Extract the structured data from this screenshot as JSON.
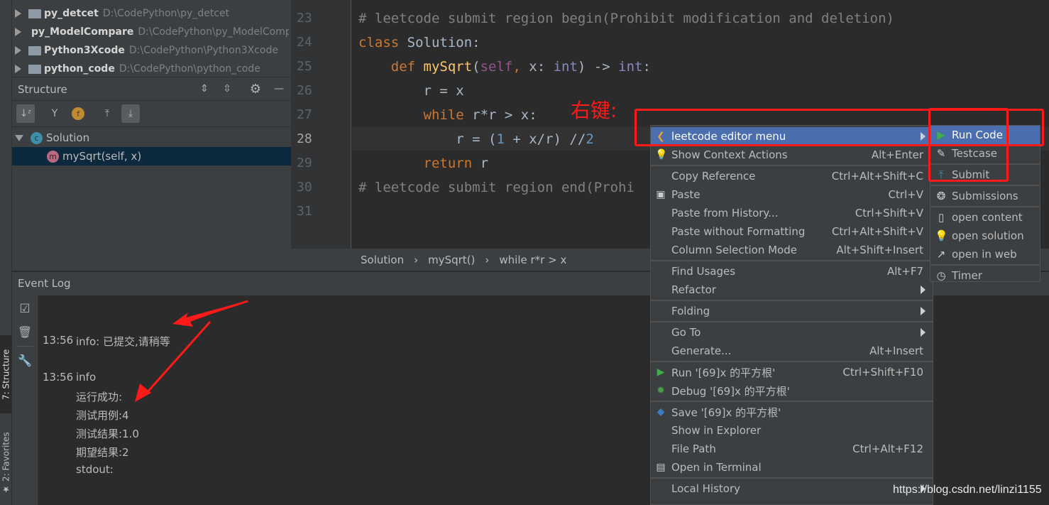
{
  "project_tree": [
    {
      "name": "py_detcet",
      "path": "D:\\CodePython\\py_detcet"
    },
    {
      "name": "py_ModelCompare",
      "path": "D:\\CodePython\\py_ModelCompare"
    },
    {
      "name": "Python3Xcode",
      "path": "D:\\CodePython\\Python3Xcode"
    },
    {
      "name": "python_code",
      "path": "D:\\CodePython\\python_code"
    }
  ],
  "structure": {
    "title": "Structure",
    "class_badge": "c",
    "class_name": "Solution",
    "method_badge": "m",
    "method_name": "mySqrt(self, x)"
  },
  "side_tabs": {
    "structure": "7: Structure",
    "favorites": "2: Favorites"
  },
  "editor": {
    "lines": [
      {
        "no": "23",
        "tokens": [
          {
            "t": "# leetcode submit region begin(Prohibit modification and deletion)",
            "c": "c"
          }
        ]
      },
      {
        "no": "24",
        "tokens": [
          {
            "t": "class ",
            "c": "k"
          },
          {
            "t": "Solution:",
            "c": ""
          }
        ]
      },
      {
        "no": "25",
        "tokens": [
          {
            "t": "    def ",
            "c": "k"
          },
          {
            "t": "mySqrt",
            "c": "f"
          },
          {
            "t": "(",
            "c": ""
          },
          {
            "t": "self",
            "c": "s"
          },
          {
            "t": ", ",
            "c": "k"
          },
          {
            "t": "x: ",
            "c": ""
          },
          {
            "t": "int",
            "c": "b"
          },
          {
            "t": ") -> ",
            "c": ""
          },
          {
            "t": "int",
            "c": "b"
          },
          {
            "t": ":",
            "c": ""
          }
        ]
      },
      {
        "no": "26",
        "tokens": [
          {
            "t": "        r = x",
            "c": ""
          }
        ]
      },
      {
        "no": "27",
        "tokens": [
          {
            "t": "        while ",
            "c": "k"
          },
          {
            "t": "r*r > x:",
            "c": ""
          }
        ]
      },
      {
        "no": "28",
        "tokens": [
          {
            "t": "            r = (",
            "c": ""
          },
          {
            "t": "1",
            "c": "n"
          },
          {
            "t": " + x/r) //",
            "c": ""
          },
          {
            "t": "2",
            "c": "n"
          }
        ]
      },
      {
        "no": "29",
        "tokens": [
          {
            "t": "        return ",
            "c": "k"
          },
          {
            "t": "r",
            "c": ""
          }
        ]
      },
      {
        "no": "30",
        "tokens": [
          {
            "t": "# leetcode submit region end(Prohi",
            "c": "c"
          }
        ]
      },
      {
        "no": "31",
        "tokens": []
      }
    ],
    "annotation": "右键:"
  },
  "breadcrumb": [
    "Solution",
    "mySqrt()",
    "while r*r > x"
  ],
  "event_log": {
    "title": "Event Log",
    "entries": [
      {
        "time": "13:56",
        "lines": [
          "info: 已提交,请稍等"
        ]
      },
      {
        "time": "13:56",
        "lines": [
          "info",
          "运行成功:",
          "测试用例:4",
          "测试结果:1.0",
          "期望结果:2",
          "stdout:"
        ]
      }
    ]
  },
  "context_menu": [
    {
      "label": "leetcode editor menu",
      "shortcut": "",
      "submenu": true,
      "icon": "leetcode-icon",
      "highlighted": true
    },
    {
      "label": "Show Context Actions",
      "shortcut": "Alt+Enter",
      "icon": "bulb-icon",
      "sep_after": true
    },
    {
      "label": "Copy Reference",
      "shortcut": "Ctrl+Alt+Shift+C"
    },
    {
      "label": "Paste",
      "shortcut": "Ctrl+V",
      "icon": "clipboard-icon"
    },
    {
      "label": "Paste from History...",
      "shortcut": "Ctrl+Shift+V"
    },
    {
      "label": "Paste without Formatting",
      "shortcut": "Ctrl+Alt+Shift+V"
    },
    {
      "label": "Column Selection Mode",
      "shortcut": "Alt+Shift+Insert",
      "sep_after": true
    },
    {
      "label": "Find Usages",
      "shortcut": "Alt+F7"
    },
    {
      "label": "Refactor",
      "submenu": true,
      "sep_after": true
    },
    {
      "label": "Folding",
      "submenu": true,
      "sep_after": true
    },
    {
      "label": "Go To",
      "submenu": true
    },
    {
      "label": "Generate...",
      "shortcut": "Alt+Insert",
      "sep_after": true
    },
    {
      "label": "Run '[69]x 的平方根'",
      "shortcut": "Ctrl+Shift+F10",
      "icon": "run-icon"
    },
    {
      "label": "Debug '[69]x 的平方根'",
      "icon": "debug-icon",
      "sep_after": true
    },
    {
      "label": "Save '[69]x 的平方根'",
      "icon": "python-icon"
    },
    {
      "label": "Show in Explorer"
    },
    {
      "label": "File Path",
      "shortcut": "Ctrl+Alt+F12"
    },
    {
      "label": "Open in Terminal",
      "icon": "terminal-icon",
      "sep_after": true
    },
    {
      "label": "Local History",
      "submenu": true
    }
  ],
  "submenu": [
    {
      "label": "Run Code",
      "icon": "run-icon",
      "highlighted": true
    },
    {
      "label": "Testcase",
      "icon": "pencil-icon",
      "sep_after": true
    },
    {
      "label": "Submit",
      "icon": "upload-icon",
      "sep_after": true
    },
    {
      "label": "Submissions",
      "icon": "submissions-icon",
      "sep_after": true
    },
    {
      "label": "open content",
      "icon": "document-icon"
    },
    {
      "label": "open solution",
      "icon": "bulb-icon"
    },
    {
      "label": "open in web",
      "icon": "external-link-icon",
      "sep_after": true
    },
    {
      "label": "Timer",
      "icon": "clock-icon",
      "submenu": true
    }
  ],
  "watermark": "https://blog.csdn.net/linzi1155",
  "colors": {
    "accent": "#4b6eaf",
    "annotation_red": "#ff1a1a",
    "selection": "#0d293e"
  }
}
